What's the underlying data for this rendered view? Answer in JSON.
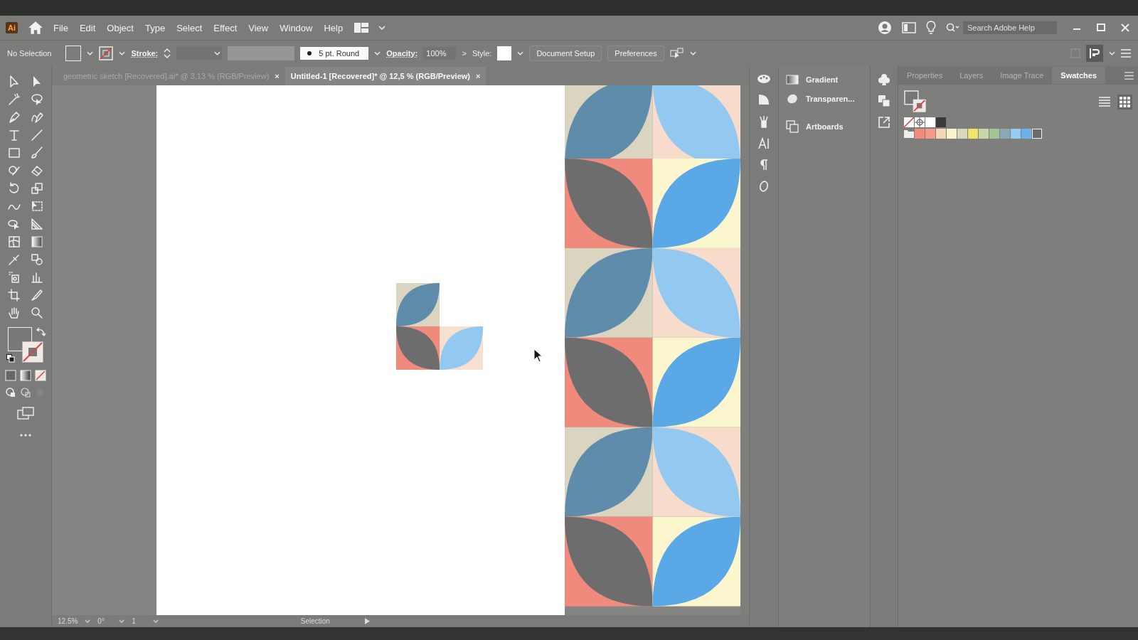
{
  "app": {
    "logo": "Ai"
  },
  "menu": [
    "File",
    "Edit",
    "Object",
    "Type",
    "Select",
    "Effect",
    "View",
    "Window",
    "Help"
  ],
  "search": {
    "placeholder": "Search Adobe Help"
  },
  "control_bar": {
    "selection": "No Selection",
    "stroke_label": "Stroke:",
    "brush": "5 pt. Round",
    "opacity_label": "Opacity:",
    "opacity": "100%",
    "opacity_more": ">",
    "style_label": "Style:",
    "buttons": [
      "Document Setup",
      "Preferences"
    ]
  },
  "tabs": [
    {
      "label": "geometric sketch [Recovered].ai* @ 3,13 % (RGB/Preview)",
      "close": "×",
      "selected": false
    },
    {
      "label": "Untitled-1 [Recovered]* @ 12,5 % (RGB/Preview)",
      "close": "×",
      "selected": true
    }
  ],
  "dock_panels": [
    "Gradient",
    "Transparen...",
    "Artboards"
  ],
  "panel_tabs": [
    {
      "label": "Properties",
      "selected": false
    },
    {
      "label": "Layers",
      "selected": false
    },
    {
      "label": "Image Trace",
      "selected": false
    },
    {
      "label": "Swatches",
      "selected": true
    }
  ],
  "swatches_basic": [
    {
      "color": "#ffffff"
    },
    {
      "color": "#3a3a3a"
    }
  ],
  "swatches_group": [
    {
      "color": "#f28b7c",
      "selected": false
    },
    {
      "color": "#f49a86",
      "selected": false
    },
    {
      "color": "#f6d6b8",
      "selected": false
    },
    {
      "color": "#faf4cc",
      "selected": false
    },
    {
      "color": "#dcd6bc",
      "selected": false
    },
    {
      "color": "#f2e66a",
      "selected": false
    },
    {
      "color": "#c6d6a4",
      "selected": false
    },
    {
      "color": "#a4c496",
      "selected": false
    },
    {
      "color": "#8aa8b8",
      "selected": false
    },
    {
      "color": "#96ccf2",
      "selected": false
    },
    {
      "color": "#6eb0ea",
      "selected": false
    },
    {
      "color": "#6a6a6a",
      "selected": true
    }
  ],
  "status_bar": {
    "zoom": "12.5%",
    "rotation": "0°",
    "artboard": "1",
    "tool": "Selection"
  }
}
